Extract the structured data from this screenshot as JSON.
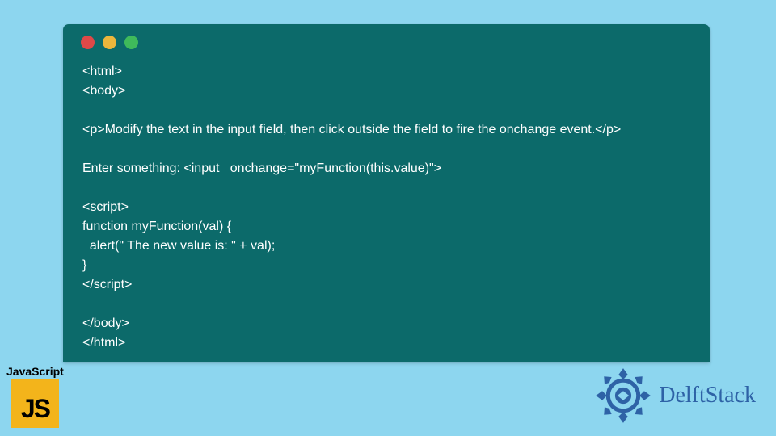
{
  "code_window": {
    "lines": "<html>\n<body>\n\n<p>Modify the text in the input field, then click outside the field to fire the onchange event.</p>\n\nEnter something: <input   onchange=\"myFunction(this.value)\">\n\n<script>\nfunction myFunction(val) {\n  alert(\" The new value is: \" + val);\n}\n</script>\n\n</body>\n</html>"
  },
  "js_badge": {
    "label": "JavaScript",
    "logo_text": "JS"
  },
  "brand": {
    "name": "DelftStack"
  }
}
